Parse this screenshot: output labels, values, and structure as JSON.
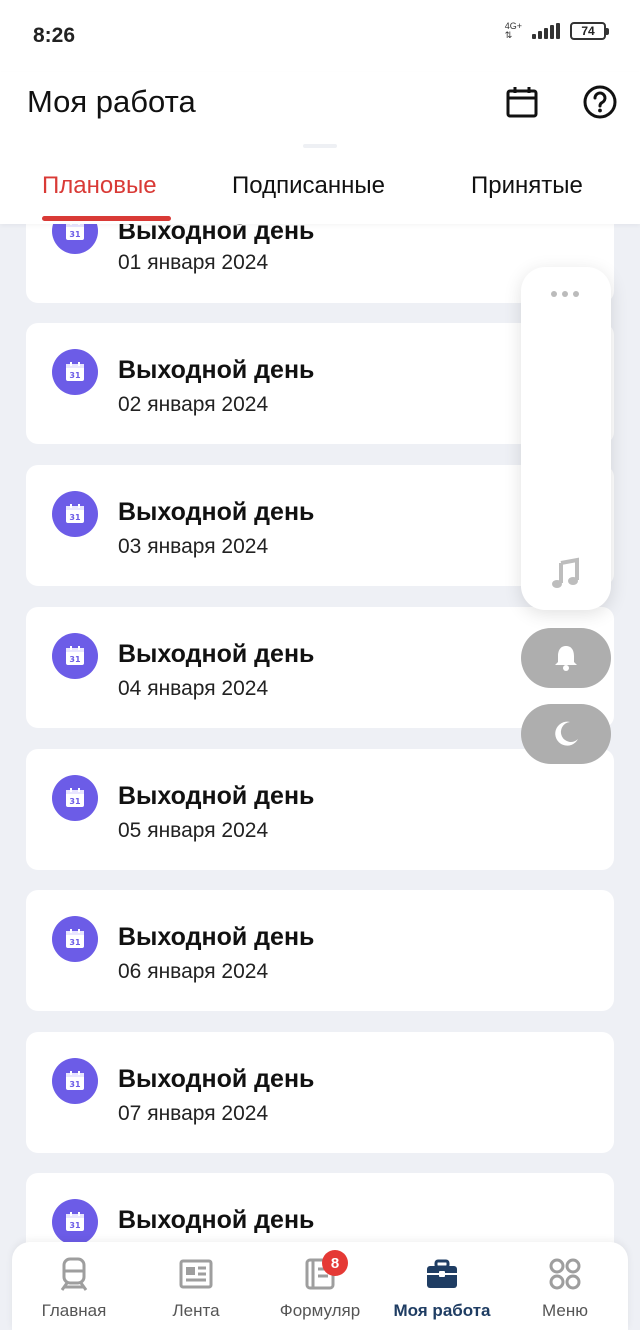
{
  "status": {
    "time": "8:26",
    "network_top": "4G+",
    "network_bottom": "⇅",
    "battery": "74"
  },
  "header": {
    "title": "Моя работа",
    "calendar_icon": "calendar-icon",
    "help_icon": "help-circle-icon"
  },
  "tabs": [
    {
      "label": "Плановые",
      "active": true
    },
    {
      "label": "Подписанные",
      "active": false
    },
    {
      "label": "Принятые",
      "active": false
    }
  ],
  "items": [
    {
      "title": "Выходной день",
      "date": "01 января 2024",
      "icon": "calendar-31-icon"
    },
    {
      "title": "Выходной день",
      "date": "02 января 2024",
      "icon": "calendar-31-icon"
    },
    {
      "title": "Выходной день",
      "date": "03 января 2024",
      "icon": "calendar-31-icon"
    },
    {
      "title": "Выходной день",
      "date": "04 января 2024",
      "icon": "calendar-31-icon"
    },
    {
      "title": "Выходной день",
      "date": "05 января 2024",
      "icon": "calendar-31-icon"
    },
    {
      "title": "Выходной день",
      "date": "06 января 2024",
      "icon": "calendar-31-icon"
    },
    {
      "title": "Выходной день",
      "date": "07 января 2024",
      "icon": "calendar-31-icon"
    },
    {
      "title": "Выходной день",
      "date": "",
      "icon": "calendar-31-icon"
    }
  ],
  "calendar_icon_day": "31",
  "floating_panel": {
    "icons": [
      "more-dots-icon",
      "music-note-icon",
      "bell-icon",
      "moon-icon"
    ]
  },
  "bottom_nav": {
    "items": [
      {
        "label": "Главная",
        "icon": "train-icon"
      },
      {
        "label": "Лента",
        "icon": "newspaper-icon"
      },
      {
        "label": "Формуляр",
        "icon": "notebook-icon",
        "badge": "8"
      },
      {
        "label": "Моя работа",
        "icon": "briefcase-icon",
        "active": true
      },
      {
        "label": "Меню",
        "icon": "grid-circles-icon"
      }
    ]
  },
  "colors": {
    "accent_red": "#d93a36",
    "icon_purple": "#6c5ce7",
    "nav_active": "#1f3d63",
    "badge_red": "#e53935",
    "background": "#eef0f5"
  }
}
